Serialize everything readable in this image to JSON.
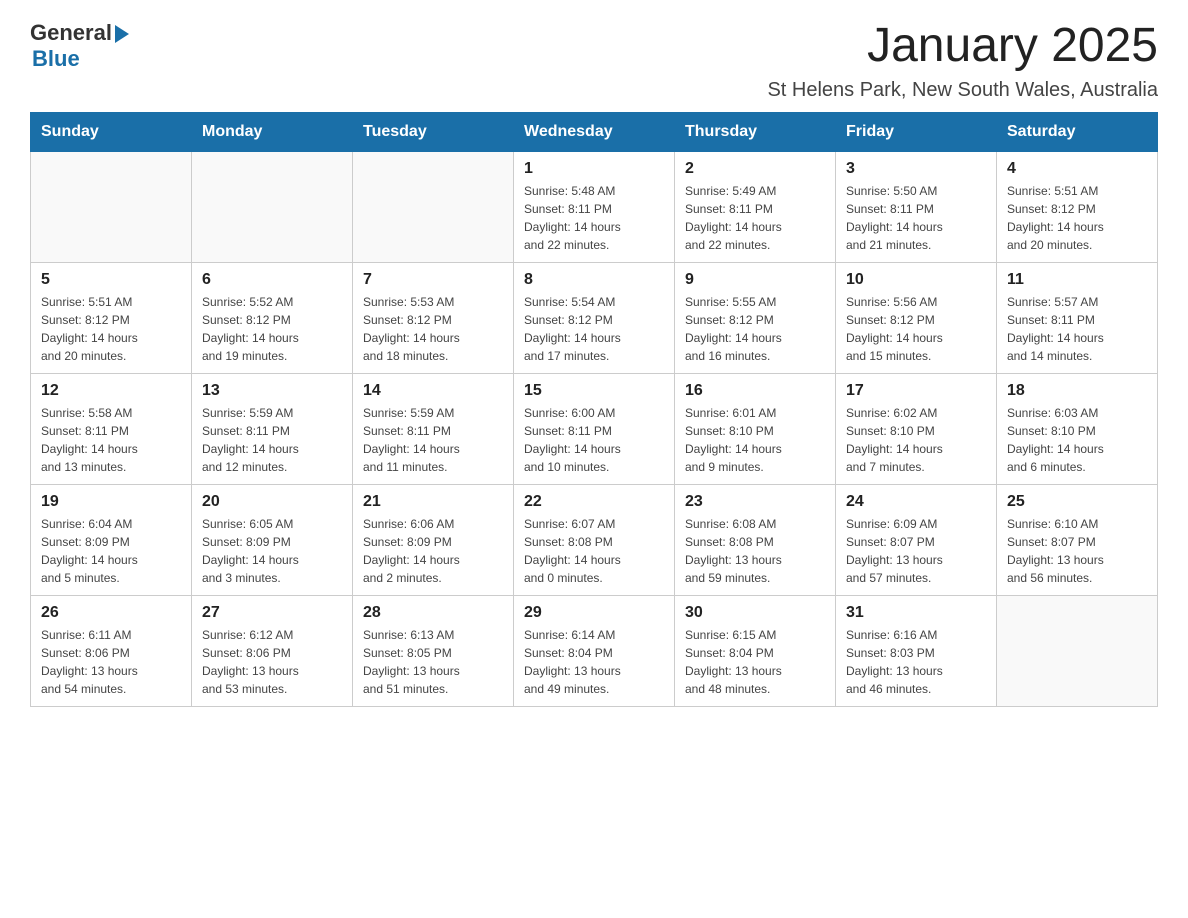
{
  "header": {
    "logo_general": "General",
    "logo_blue": "Blue",
    "month_title": "January 2025",
    "location": "St Helens Park, New South Wales, Australia"
  },
  "days_of_week": [
    "Sunday",
    "Monday",
    "Tuesday",
    "Wednesday",
    "Thursday",
    "Friday",
    "Saturday"
  ],
  "weeks": [
    [
      {
        "day": "",
        "info": ""
      },
      {
        "day": "",
        "info": ""
      },
      {
        "day": "",
        "info": ""
      },
      {
        "day": "1",
        "info": "Sunrise: 5:48 AM\nSunset: 8:11 PM\nDaylight: 14 hours\nand 22 minutes."
      },
      {
        "day": "2",
        "info": "Sunrise: 5:49 AM\nSunset: 8:11 PM\nDaylight: 14 hours\nand 22 minutes."
      },
      {
        "day": "3",
        "info": "Sunrise: 5:50 AM\nSunset: 8:11 PM\nDaylight: 14 hours\nand 21 minutes."
      },
      {
        "day": "4",
        "info": "Sunrise: 5:51 AM\nSunset: 8:12 PM\nDaylight: 14 hours\nand 20 minutes."
      }
    ],
    [
      {
        "day": "5",
        "info": "Sunrise: 5:51 AM\nSunset: 8:12 PM\nDaylight: 14 hours\nand 20 minutes."
      },
      {
        "day": "6",
        "info": "Sunrise: 5:52 AM\nSunset: 8:12 PM\nDaylight: 14 hours\nand 19 minutes."
      },
      {
        "day": "7",
        "info": "Sunrise: 5:53 AM\nSunset: 8:12 PM\nDaylight: 14 hours\nand 18 minutes."
      },
      {
        "day": "8",
        "info": "Sunrise: 5:54 AM\nSunset: 8:12 PM\nDaylight: 14 hours\nand 17 minutes."
      },
      {
        "day": "9",
        "info": "Sunrise: 5:55 AM\nSunset: 8:12 PM\nDaylight: 14 hours\nand 16 minutes."
      },
      {
        "day": "10",
        "info": "Sunrise: 5:56 AM\nSunset: 8:12 PM\nDaylight: 14 hours\nand 15 minutes."
      },
      {
        "day": "11",
        "info": "Sunrise: 5:57 AM\nSunset: 8:11 PM\nDaylight: 14 hours\nand 14 minutes."
      }
    ],
    [
      {
        "day": "12",
        "info": "Sunrise: 5:58 AM\nSunset: 8:11 PM\nDaylight: 14 hours\nand 13 minutes."
      },
      {
        "day": "13",
        "info": "Sunrise: 5:59 AM\nSunset: 8:11 PM\nDaylight: 14 hours\nand 12 minutes."
      },
      {
        "day": "14",
        "info": "Sunrise: 5:59 AM\nSunset: 8:11 PM\nDaylight: 14 hours\nand 11 minutes."
      },
      {
        "day": "15",
        "info": "Sunrise: 6:00 AM\nSunset: 8:11 PM\nDaylight: 14 hours\nand 10 minutes."
      },
      {
        "day": "16",
        "info": "Sunrise: 6:01 AM\nSunset: 8:10 PM\nDaylight: 14 hours\nand 9 minutes."
      },
      {
        "day": "17",
        "info": "Sunrise: 6:02 AM\nSunset: 8:10 PM\nDaylight: 14 hours\nand 7 minutes."
      },
      {
        "day": "18",
        "info": "Sunrise: 6:03 AM\nSunset: 8:10 PM\nDaylight: 14 hours\nand 6 minutes."
      }
    ],
    [
      {
        "day": "19",
        "info": "Sunrise: 6:04 AM\nSunset: 8:09 PM\nDaylight: 14 hours\nand 5 minutes."
      },
      {
        "day": "20",
        "info": "Sunrise: 6:05 AM\nSunset: 8:09 PM\nDaylight: 14 hours\nand 3 minutes."
      },
      {
        "day": "21",
        "info": "Sunrise: 6:06 AM\nSunset: 8:09 PM\nDaylight: 14 hours\nand 2 minutes."
      },
      {
        "day": "22",
        "info": "Sunrise: 6:07 AM\nSunset: 8:08 PM\nDaylight: 14 hours\nand 0 minutes."
      },
      {
        "day": "23",
        "info": "Sunrise: 6:08 AM\nSunset: 8:08 PM\nDaylight: 13 hours\nand 59 minutes."
      },
      {
        "day": "24",
        "info": "Sunrise: 6:09 AM\nSunset: 8:07 PM\nDaylight: 13 hours\nand 57 minutes."
      },
      {
        "day": "25",
        "info": "Sunrise: 6:10 AM\nSunset: 8:07 PM\nDaylight: 13 hours\nand 56 minutes."
      }
    ],
    [
      {
        "day": "26",
        "info": "Sunrise: 6:11 AM\nSunset: 8:06 PM\nDaylight: 13 hours\nand 54 minutes."
      },
      {
        "day": "27",
        "info": "Sunrise: 6:12 AM\nSunset: 8:06 PM\nDaylight: 13 hours\nand 53 minutes."
      },
      {
        "day": "28",
        "info": "Sunrise: 6:13 AM\nSunset: 8:05 PM\nDaylight: 13 hours\nand 51 minutes."
      },
      {
        "day": "29",
        "info": "Sunrise: 6:14 AM\nSunset: 8:04 PM\nDaylight: 13 hours\nand 49 minutes."
      },
      {
        "day": "30",
        "info": "Sunrise: 6:15 AM\nSunset: 8:04 PM\nDaylight: 13 hours\nand 48 minutes."
      },
      {
        "day": "31",
        "info": "Sunrise: 6:16 AM\nSunset: 8:03 PM\nDaylight: 13 hours\nand 46 minutes."
      },
      {
        "day": "",
        "info": ""
      }
    ]
  ]
}
